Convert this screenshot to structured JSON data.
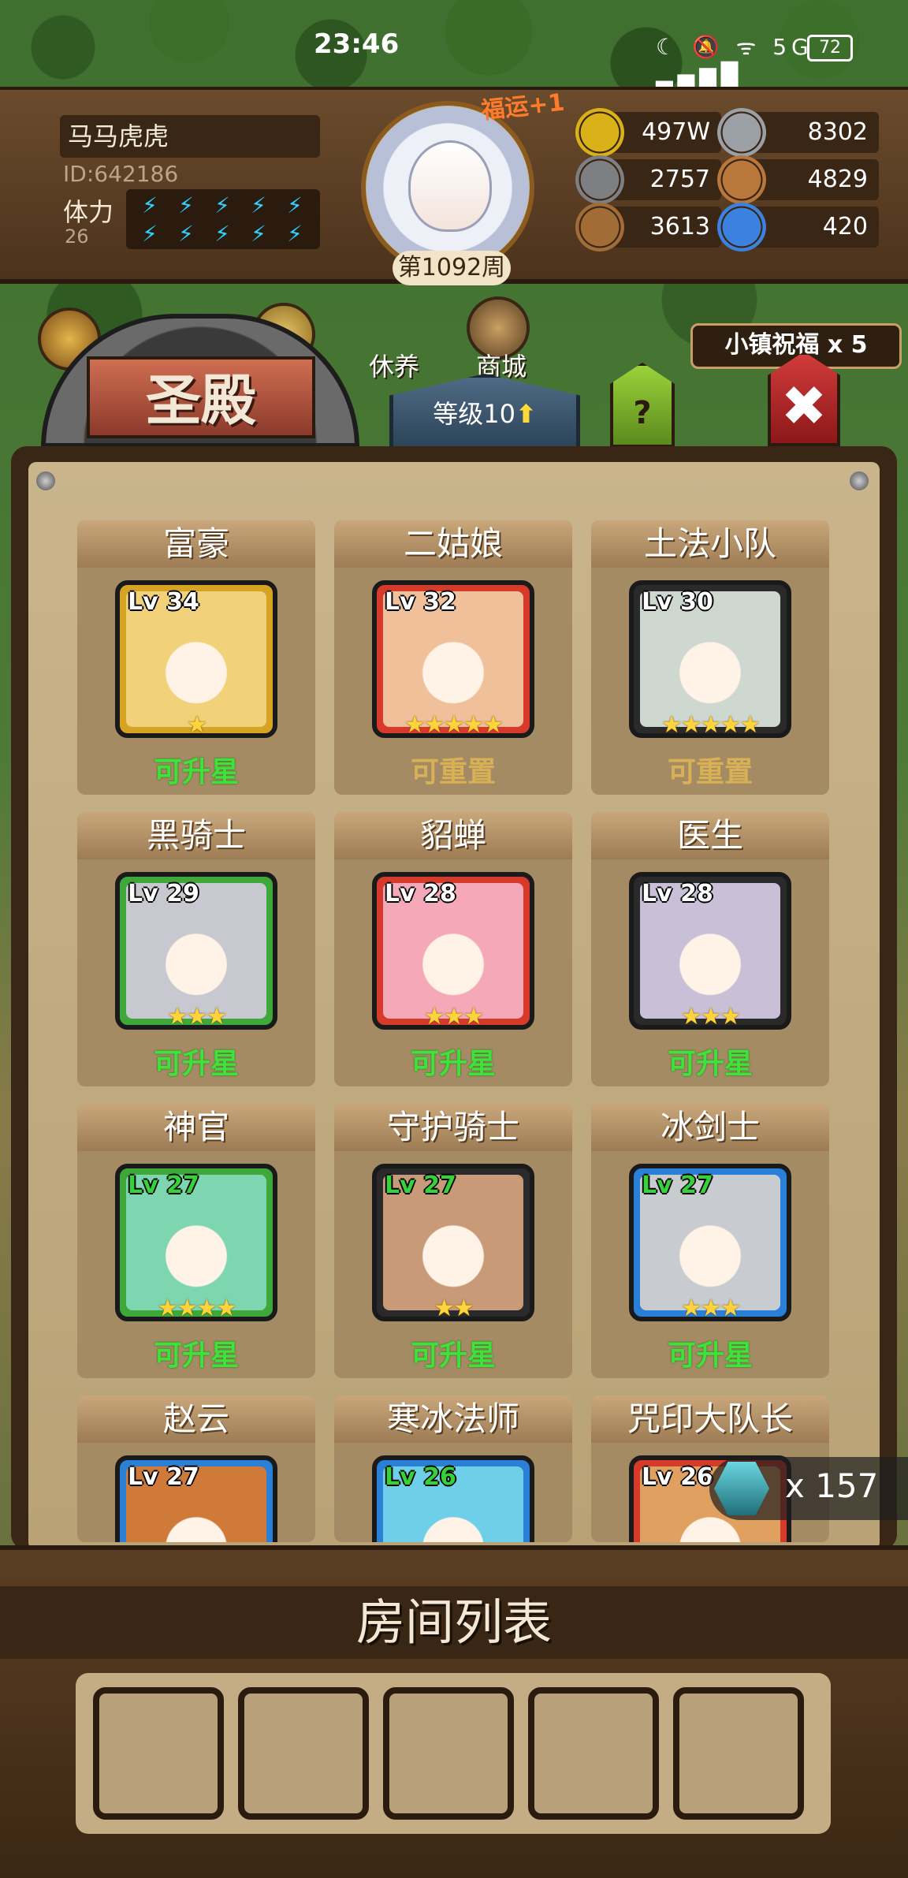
{
  "status_bar": {
    "time": "23:46",
    "icons": "☾ 🔕 ᯤ 5G ▂▄▆█",
    "battery": "72"
  },
  "player": {
    "name": "马马虎虎",
    "id": "ID:642186",
    "stamina_label": "体力",
    "stamina_value": "26",
    "stamina_bolts": 10
  },
  "portrait": {
    "week": "第1092周",
    "luck": "福运+1"
  },
  "resources": [
    {
      "icon": "gold-coin-icon",
      "value": "497W",
      "color": "#d9b21a"
    },
    {
      "icon": "iron-ingot-icon",
      "value": "8302",
      "color": "#9aa0a6"
    },
    {
      "icon": "stone-ore-icon",
      "value": "2757",
      "color": "#7d7f83"
    },
    {
      "icon": "leather-hide-icon",
      "value": "4829",
      "color": "#b9773b"
    },
    {
      "icon": "wood-log-icon",
      "value": "3613",
      "color": "#a26c36"
    },
    {
      "icon": "crystal-icon",
      "value": "420",
      "color": "#3b82e0"
    }
  ],
  "subnav": {
    "rest": "休养",
    "shop": "商城",
    "blessing": "小镇祝福 x 5"
  },
  "page": {
    "title": "圣殿",
    "level": "等级10",
    "help": "?"
  },
  "heroes": [
    {
      "name": "富豪",
      "level": "Lv 34",
      "stars": "★",
      "status": "可升星",
      "status_type": "up",
      "frame": "#d6a323",
      "art": "#f1d27a",
      "lv_green": false
    },
    {
      "name": "二姑娘",
      "level": "Lv 32",
      "stars": "★★★★★",
      "status": "可重置",
      "status_type": "reset",
      "frame": "#d63a2a",
      "art": "#f0c09a",
      "lv_green": false
    },
    {
      "name": "土法小队",
      "level": "Lv 30",
      "stars": "★★★★★",
      "status": "可重置",
      "status_type": "reset",
      "frame": "#2a2a2a",
      "art": "#cfd8d0",
      "lv_green": false
    },
    {
      "name": "黑骑士",
      "level": "Lv 29",
      "stars": "★★★",
      "status": "可升星",
      "status_type": "up",
      "frame": "#3fa83a",
      "art": "#c8c8d0",
      "lv_green": false
    },
    {
      "name": "貂蝉",
      "level": "Lv 28",
      "stars": "★★★",
      "status": "可升星",
      "status_type": "up",
      "frame": "#d63a2a",
      "art": "#f4a8b8",
      "lv_green": false
    },
    {
      "name": "医生",
      "level": "Lv 28",
      "stars": "★★★",
      "status": "可升星",
      "status_type": "up",
      "frame": "#2a2a2a",
      "art": "#c9c0d8",
      "lv_green": false
    },
    {
      "name": "神官",
      "level": "Lv 27",
      "stars": "★★★★",
      "status": "可升星",
      "status_type": "up",
      "frame": "#3fa83a",
      "art": "#7ed6b0",
      "lv_green": true
    },
    {
      "name": "守护骑士",
      "level": "Lv 27",
      "stars": "★★",
      "status": "可升星",
      "status_type": "up",
      "frame": "#2a2a2a",
      "art": "#c89a78",
      "lv_green": true
    },
    {
      "name": "冰剑士",
      "level": "Lv 27",
      "stars": "★★★",
      "status": "可升星",
      "status_type": "up",
      "frame": "#2a7fd6",
      "art": "#c8ccd0",
      "lv_green": true
    },
    {
      "name": "赵云",
      "level": "Lv 27",
      "stars": "",
      "status": "",
      "status_type": "up",
      "frame": "#2a7fd6",
      "art": "#d07a3a",
      "lv_green": false
    },
    {
      "name": "寒冰法师",
      "level": "Lv 26",
      "stars": "",
      "status": "",
      "status_type": "up",
      "frame": "#2a7fd6",
      "art": "#6ed0e8",
      "lv_green": true
    },
    {
      "name": "咒印大队长",
      "level": "Lv 26",
      "stars": "",
      "status": "",
      "status_type": "up",
      "frame": "#d63a2a",
      "art": "#e0a060",
      "lv_green": false
    }
  ],
  "gem": {
    "count": "x 157"
  },
  "room": {
    "title": "房间列表",
    "slots": 5
  }
}
